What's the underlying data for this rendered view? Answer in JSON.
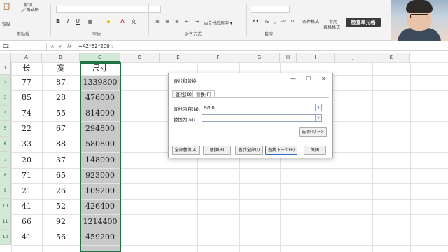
{
  "ribbon": {
    "paste_label": "粘贴",
    "cut_label": "剪切",
    "format_painter_label": "格式刷",
    "clipboard_group": "剪贴板",
    "font_group": "字体",
    "align_group": "对齐方式",
    "merge_label": "合并后居中",
    "number_group": "数字",
    "conditional_format_label": "条件格式",
    "apply_label": "套用",
    "table_format_label": "表格格式",
    "check_cell_label": "检查单元格",
    "bold": "B",
    "italic": "I",
    "underline": "U",
    "font_color_glyph": "A",
    "fill_glyph": "◆",
    "percent": "%",
    "comma": ",",
    "dec_more": "←0",
    "dec_less": ".00",
    "accent": "#217346"
  },
  "formula_bar": {
    "name_box": "C2",
    "cancel": "×",
    "enter": "✓",
    "fx": "fx",
    "formula": "=A2*B2*200 ;"
  },
  "columns": [
    "A",
    "B",
    "C",
    "D",
    "E",
    "F",
    "G",
    "H",
    "I",
    "J",
    "K"
  ],
  "rows": [
    "1",
    "2",
    "3",
    "4",
    "5",
    "6",
    "7",
    "8",
    "9",
    "10",
    "11",
    "12"
  ],
  "table": {
    "headers": [
      "长",
      "宽",
      "尺寸"
    ],
    "data": [
      [
        "77",
        "87",
        "1339800"
      ],
      [
        "85",
        "28",
        "476000"
      ],
      [
        "74",
        "55",
        "814000"
      ],
      [
        "22",
        "67",
        "294800"
      ],
      [
        "33",
        "88",
        "580800"
      ],
      [
        "20",
        "37",
        "148000"
      ],
      [
        "71",
        "65",
        "923000"
      ],
      [
        "21",
        "26",
        "109200"
      ],
      [
        "41",
        "52",
        "426400"
      ],
      [
        "66",
        "92",
        "1214400"
      ],
      [
        "41",
        "56",
        "459200"
      ]
    ]
  },
  "dialog": {
    "title": "查找和替换",
    "min": "—",
    "max": "☐",
    "close": "✕",
    "tab_find": "查找(D)",
    "tab_replace": "替换(P)",
    "find_label": "查找内容(N):",
    "find_value": "*200",
    "replace_label": "替换为(E):",
    "replace_value": "",
    "dropdown_glyph": "∨",
    "options_button": "选项(T) >>",
    "replace_all_button": "全部替换(A)",
    "replace_button": "替换(R)",
    "find_all_button": "查找全部(I)",
    "find_next_button": "查找下一个(F)",
    "close_button": "关闭"
  }
}
